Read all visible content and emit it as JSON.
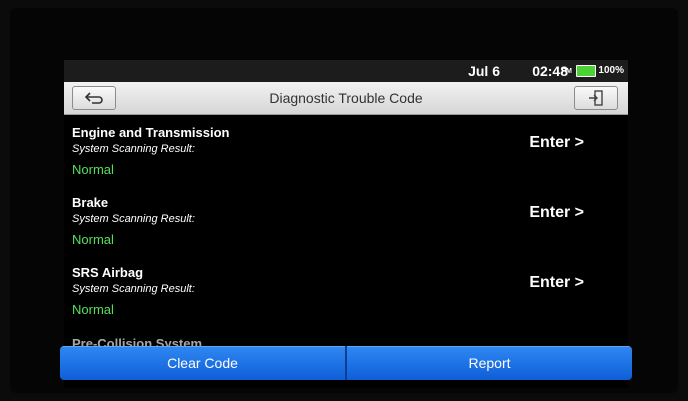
{
  "status_bar": {
    "date": "Jul 6",
    "time": "02:48",
    "ampm": "PM",
    "battery_percent": "100%",
    "battery_level": 1.0
  },
  "title_bar": {
    "title": "Diagnostic Trouble Code",
    "back_icon": "back-arrow-icon",
    "exit_icon": "exit-door-icon"
  },
  "systems": [
    {
      "name": "Engine and Transmission",
      "result_label": "System Scanning Result:",
      "status": "Normal",
      "action": "Enter >"
    },
    {
      "name": "Brake",
      "result_label": "System Scanning Result:",
      "status": "Normal",
      "action": "Enter >"
    },
    {
      "name": "SRS Airbag",
      "result_label": "System Scanning Result:",
      "status": "Normal",
      "action": "Enter >"
    }
  ],
  "partial_next_item": "Pre-Collision System",
  "buttons": {
    "clear_code": "Clear Code",
    "report": "Report"
  },
  "colors": {
    "status_normal": "#55e05a",
    "button_blue": "#1a6ee6",
    "battery_green": "#4cd137"
  }
}
